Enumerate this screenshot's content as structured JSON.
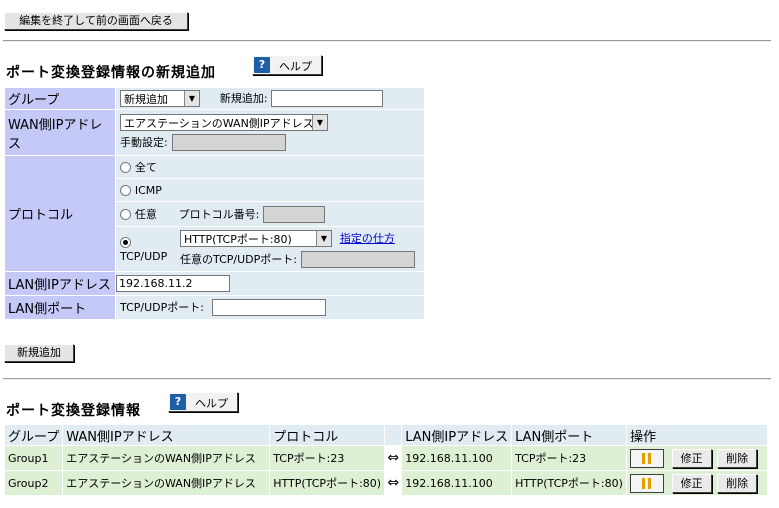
{
  "top": {
    "back_button": "編集を終了して前の画面へ戻る"
  },
  "add_section": {
    "title": "ポート変換登録情報の新規追加",
    "help_label": "ヘルプ",
    "group": {
      "label": "グループ",
      "select_value": "新規追加",
      "new_label": "新規追加:",
      "new_value": ""
    },
    "wan_ip": {
      "label": "WAN側IPアドレス",
      "select_value": "エアステーションのWAN側IPアドレス",
      "manual_label": "手動設定:",
      "manual_value": ""
    },
    "protocol": {
      "label": "プロトコル",
      "opt_all": "全て",
      "opt_icmp": "ICMP",
      "opt_any": "任意",
      "proto_num_label": "プロトコル番号:",
      "opt_tcpudp": "TCP/UDP",
      "tcpudp_select": "HTTP(TCPポート:80)",
      "howto_link": "指定の仕方",
      "any_port_label": "任意のTCP/UDPポート:",
      "selected": "TCP/UDP"
    },
    "lan_ip": {
      "label": "LAN側IPアドレス",
      "value": "192.168.11.2"
    },
    "lan_port": {
      "label": "LAN側ポート",
      "port_label": "TCP/UDPポート:",
      "value": ""
    },
    "add_button": "新規追加"
  },
  "list_section": {
    "title": "ポート変換登録情報",
    "help_label": "ヘルプ",
    "headers": {
      "group": "グループ",
      "wan_ip": "WAN側IPアドレス",
      "protocol": "プロトコル",
      "lan_ip": "LAN側IPアドレス",
      "lan_port": "LAN側ポート",
      "ops": "操作"
    },
    "arrow": "⇔",
    "edit_label": "修正",
    "delete_label": "削除",
    "rows": [
      {
        "group": "Group1",
        "wan_ip": "エアステーションのWAN側IPアドレス",
        "protocol": "TCPポート:23",
        "lan_ip": "192.168.11.100",
        "lan_port": "TCPポート:23"
      },
      {
        "group": "Group2",
        "wan_ip": "エアステーションのWAN側IPアドレス",
        "protocol": "HTTP(TCPポート:80)",
        "lan_ip": "192.168.11.100",
        "lan_port": "HTTP(TCPポート:80)"
      }
    ]
  }
}
